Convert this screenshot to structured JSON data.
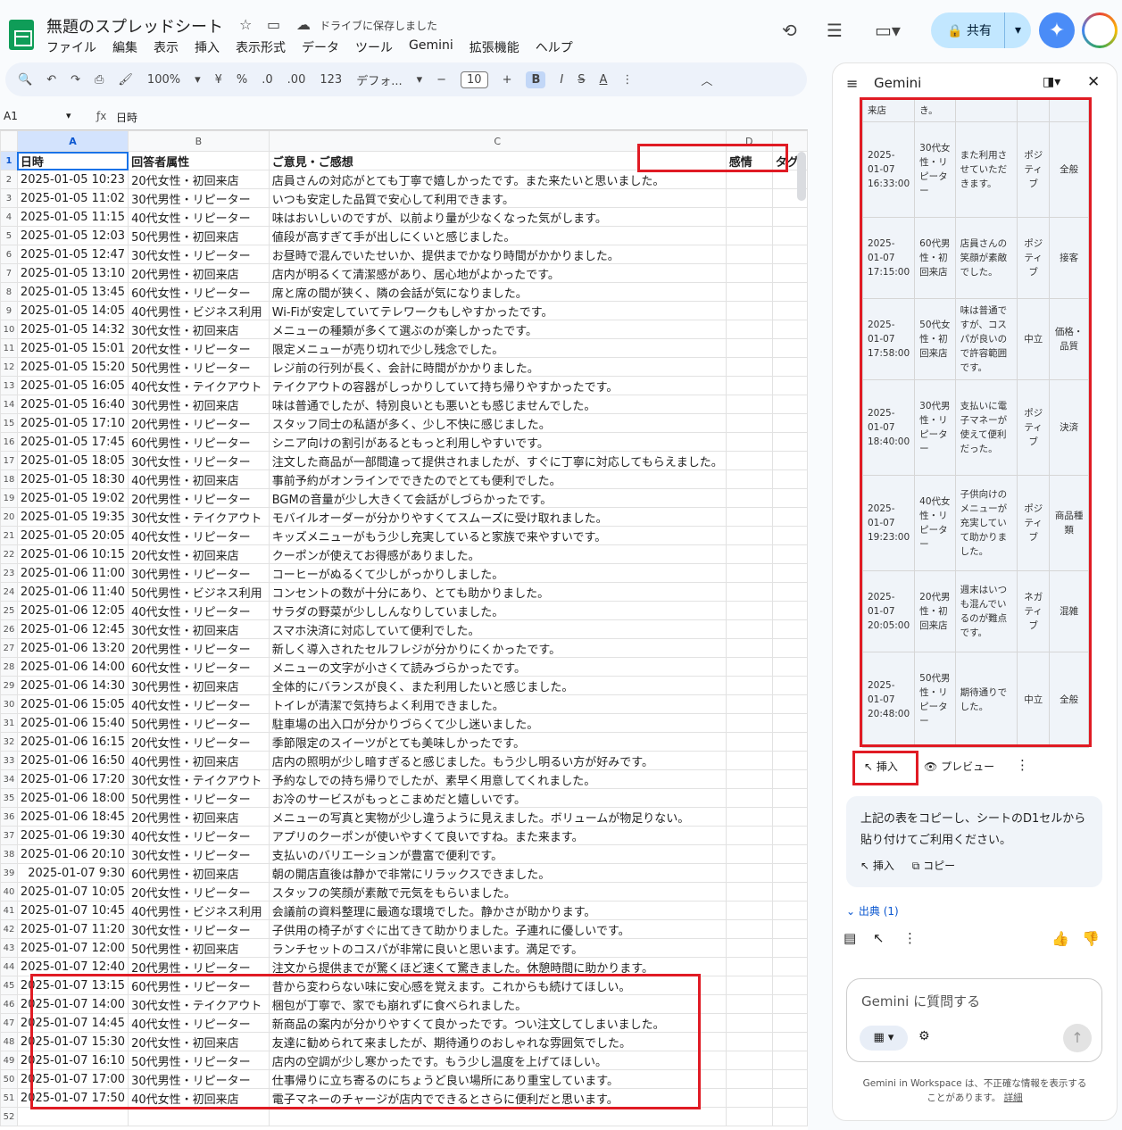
{
  "app": {
    "doc_title": "無題のスプレッドシート",
    "saved_status": "ドライブに保存しました",
    "menu": [
      "ファイル",
      "編集",
      "表示",
      "挿入",
      "表示形式",
      "データ",
      "ツール",
      "Gemini",
      "拡張機能",
      "ヘルプ"
    ],
    "share_label": "共有",
    "toolbar": {
      "zoom": "100%",
      "currency": "¥",
      "percent": "%",
      "dec_minus": ".0",
      "dec_plus": ".00",
      "format_123": "123",
      "font": "デフォ...",
      "font_size": "10",
      "bold": "B",
      "italic": "I",
      "strike": "S",
      "text_color": "A"
    },
    "name_box": "A1",
    "formula": "日時",
    "accent_color": "#0b57d0",
    "highlight_color": "#e01b24"
  },
  "sheet": {
    "columns": [
      "A",
      "B",
      "C",
      "D"
    ],
    "header": [
      "日時",
      "回答者属性",
      "ご意見・ご感想",
      "感情",
      "タグ"
    ],
    "rows": [
      [
        "2025-01-05 10:23",
        "20代女性・初回来店",
        "店員さんの対応がとても丁寧で嬉しかったです。また来たいと思いました。"
      ],
      [
        "2025-01-05 11:02",
        "30代男性・リピーター",
        "いつも安定した品質で安心して利用できます。"
      ],
      [
        "2025-01-05 11:15",
        "40代女性・リピーター",
        "味はおいしいのですが、以前より量が少なくなった気がします。"
      ],
      [
        "2025-01-05 12:03",
        "50代男性・初回来店",
        "値段が高すぎて手が出しにくいと感じました。"
      ],
      [
        "2025-01-05 12:47",
        "30代女性・リピーター",
        "お昼時で混んでいたせいか、提供までかなり時間がかかりました。"
      ],
      [
        "2025-01-05 13:10",
        "20代男性・初回来店",
        "店内が明るくて清潔感があり、居心地がよかったです。"
      ],
      [
        "2025-01-05 13:45",
        "60代女性・リピーター",
        "席と席の間が狭く、隣の会話が気になりました。"
      ],
      [
        "2025-01-05 14:05",
        "40代男性・ビジネス利用",
        "Wi-Fiが安定していてテレワークもしやすかったです。"
      ],
      [
        "2025-01-05 14:32",
        "30代女性・初回来店",
        "メニューの種類が多くて選ぶのが楽しかったです。"
      ],
      [
        "2025-01-05 15:01",
        "20代女性・リピーター",
        "限定メニューが売り切れで少し残念でした。"
      ],
      [
        "2025-01-05 15:20",
        "50代男性・リピーター",
        "レジ前の行列が長く、会計に時間がかかりました。"
      ],
      [
        "2025-01-05 16:05",
        "40代女性・テイクアウト",
        "テイクアウトの容器がしっかりしていて持ち帰りやすかったです。"
      ],
      [
        "2025-01-05 16:40",
        "30代男性・初回来店",
        "味は普通でしたが、特別良いとも悪いとも感じませんでした。"
      ],
      [
        "2025-01-05 17:10",
        "20代男性・リピーター",
        "スタッフ同士の私語が多く、少し不快に感じました。"
      ],
      [
        "2025-01-05 17:45",
        "60代男性・リピーター",
        "シニア向けの割引があるともっと利用しやすいです。"
      ],
      [
        "2025-01-05 18:05",
        "30代女性・リピーター",
        "注文した商品が一部間違って提供されましたが、すぐに丁寧に対応してもらえました。"
      ],
      [
        "2025-01-05 18:30",
        "40代男性・初回来店",
        "事前予約がオンラインでできたのでとても便利でした。"
      ],
      [
        "2025-01-05 19:02",
        "20代男性・リピーター",
        "BGMの音量が少し大きくて会話がしづらかったです。"
      ],
      [
        "2025-01-05 19:35",
        "30代女性・テイクアウト",
        "モバイルオーダーが分かりやすくてスムーズに受け取れました。"
      ],
      [
        "2025-01-05 20:05",
        "40代女性・リピーター",
        "キッズメニューがもう少し充実していると家族で来やすいです。"
      ],
      [
        "2025-01-06 10:15",
        "20代女性・初回来店",
        "クーポンが使えてお得感がありました。"
      ],
      [
        "2025-01-06 11:00",
        "30代男性・リピーター",
        "コーヒーがぬるくて少しがっかりしました。"
      ],
      [
        "2025-01-06 11:40",
        "50代男性・ビジネス利用",
        "コンセントの数が十分にあり、とても助かりました。"
      ],
      [
        "2025-01-06 12:05",
        "40代女性・リピーター",
        "サラダの野菜が少ししんなりしていました。"
      ],
      [
        "2025-01-06 12:45",
        "30代女性・初回来店",
        "スマホ決済に対応していて便利でした。"
      ],
      [
        "2025-01-06 13:20",
        "20代男性・リピーター",
        "新しく導入されたセルフレジが分かりにくかったです。"
      ],
      [
        "2025-01-06 14:00",
        "60代女性・リピーター",
        "メニューの文字が小さくて読みづらかったです。"
      ],
      [
        "2025-01-06 14:30",
        "30代男性・初回来店",
        "全体的にバランスが良く、また利用したいと感じました。"
      ],
      [
        "2025-01-06 15:05",
        "40代女性・リピーター",
        "トイレが清潔で気持ちよく利用できました。"
      ],
      [
        "2025-01-06 15:40",
        "50代男性・リピーター",
        "駐車場の出入口が分かりづらくて少し迷いました。"
      ],
      [
        "2025-01-06 16:15",
        "20代女性・リピーター",
        "季節限定のスイーツがとても美味しかったです。"
      ],
      [
        "2025-01-06 16:50",
        "40代男性・初回来店",
        "店内の照明が少し暗すぎると感じました。もう少し明るい方が好みです。"
      ],
      [
        "2025-01-06 17:20",
        "30代女性・テイクアウト",
        "予約なしでの持ち帰りでしたが、素早く用意してくれました。"
      ],
      [
        "2025-01-06 18:00",
        "50代男性・リピーター",
        "お冷のサービスがもっとこまめだと嬉しいです。"
      ],
      [
        "2025-01-06 18:45",
        "20代男性・初回来店",
        "メニューの写真と実物が少し違うように見えました。ボリュームが物足りない。"
      ],
      [
        "2025-01-06 19:30",
        "40代女性・リピーター",
        "アプリのクーポンが使いやすくて良いですね。また来ます。"
      ],
      [
        "2025-01-06 20:10",
        "30代女性・リピーター",
        "支払いのバリエーションが豊富で便利です。"
      ],
      [
        "2025-01-07 9:30",
        "60代男性・初回来店",
        "朝の開店直後は静かで非常にリラックスできました。"
      ],
      [
        "2025-01-07 10:05",
        "20代女性・リピーター",
        "スタッフの笑顔が素敵で元気をもらいました。"
      ],
      [
        "2025-01-07 10:45",
        "40代男性・ビジネス利用",
        "会議前の資料整理に最適な環境でした。静かさが助かります。"
      ],
      [
        "2025-01-07 11:20",
        "30代女性・リピーター",
        "子供用の椅子がすぐに出てきて助かりました。子連れに優しいです。"
      ],
      [
        "2025-01-07 12:00",
        "50代男性・初回来店",
        "ランチセットのコスパが非常に良いと思います。満足です。"
      ],
      [
        "2025-01-07 12:40",
        "20代男性・リピーター",
        "注文から提供までが驚くほど速くて驚きました。休憩時間に助かります。"
      ],
      [
        "2025-01-07 13:15",
        "60代男性・リピーター",
        "昔から変わらない味に安心感を覚えます。これからも続けてほしい。"
      ],
      [
        "2025-01-07 14:00",
        "30代女性・テイクアウト",
        "梱包が丁寧で、家でも崩れずに食べられました。"
      ],
      [
        "2025-01-07 14:45",
        "40代女性・リピーター",
        "新商品の案内が分かりやすくて良かったです。つい注文してしまいました。"
      ],
      [
        "2025-01-07 15:30",
        "20代女性・初回来店",
        "友達に勧められて来ましたが、期待通りのおしゃれな雰囲気でした。"
      ],
      [
        "2025-01-07 16:10",
        "50代男性・リピーター",
        "店内の空調が少し寒かったです。もう少し温度を上げてほしい。"
      ],
      [
        "2025-01-07 17:00",
        "30代男性・リピーター",
        "仕事帰りに立ち寄るのにちょうど良い場所にあり重宝しています。"
      ],
      [
        "2025-01-07 17:50",
        "40代女性・初回来店",
        "電子マネーのチャージが店内でできるとさらに便利だと思います。"
      ]
    ]
  },
  "gemini": {
    "title": "Gemini",
    "partial_row": [
      "来店",
      "き。",
      "",
      "",
      ""
    ],
    "table_rows": [
      [
        "2025-01-07 16:33:00",
        "30代女性・リピーター",
        "また利用させていただきます。",
        "ポジティブ",
        "全般"
      ],
      [
        "2025-01-07 17:15:00",
        "60代男性・初回来店",
        "店員さんの笑顔が素敵でした。",
        "ポジティブ",
        "接客"
      ],
      [
        "2025-01-07 17:58:00",
        "50代女性・初回来店",
        "味は普通ですが、コスパが良いので許容範囲です。",
        "中立",
        "価格・品質"
      ],
      [
        "2025-01-07 18:40:00",
        "30代男性・リピーター",
        "支払いに電子マネーが使えて便利だった。",
        "ポジティブ",
        "決済"
      ],
      [
        "2025-01-07 19:23:00",
        "40代女性・リピーター",
        "子供向けのメニューが充実していて助かりました。",
        "ポジティブ",
        "商品種類"
      ],
      [
        "2025-01-07 20:05:00",
        "20代男性・初回来店",
        "週末はいつも混んでいるのが難点です。",
        "ネガティブ",
        "混雑"
      ],
      [
        "2025-01-07 20:48:00",
        "50代男性・リピーター",
        "期待通りでした。",
        "中立",
        "全般"
      ]
    ],
    "insert_label": "挿入",
    "preview_label": "プレビュー",
    "message": "上記の表をコピーし、シートのD1セルから貼り付けてご利用ください。",
    "msg_insert": "挿入",
    "msg_copy": "コピー",
    "sources_label": "出典 (1)",
    "ask_placeholder": "Gemini に質問する",
    "disclaimer": "Gemini in Workspace は、不正確な情報を表示することがあります。",
    "details_link": "詳細"
  }
}
